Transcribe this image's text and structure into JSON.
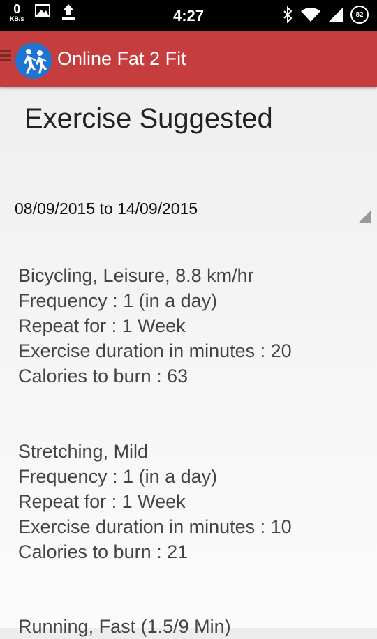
{
  "status_bar": {
    "net_speed": "0",
    "net_unit": "KB/s",
    "time": "4:27",
    "battery": "82"
  },
  "app_bar": {
    "title": "Online Fat 2 Fit"
  },
  "page": {
    "title": "Exercise Suggested",
    "date_range": "08/09/2015 to 14/09/2015"
  },
  "exercises": [
    {
      "name": "Bicycling, Leisure, 8.8 km/hr",
      "frequency": "Frequency : 1 (in a day)",
      "repeat": "Repeat for : 1 Week",
      "duration": "Exercise duration in minutes : 20",
      "calories": "Calories to burn : 63"
    },
    {
      "name": "Stretching, Mild",
      "frequency": "Frequency : 1 (in a day)",
      "repeat": "Repeat for : 1 Week",
      "duration": "Exercise duration in minutes : 10",
      "calories": "Calories to burn : 21"
    },
    {
      "name": "Running, Fast (1.5/9 Min)"
    }
  ]
}
